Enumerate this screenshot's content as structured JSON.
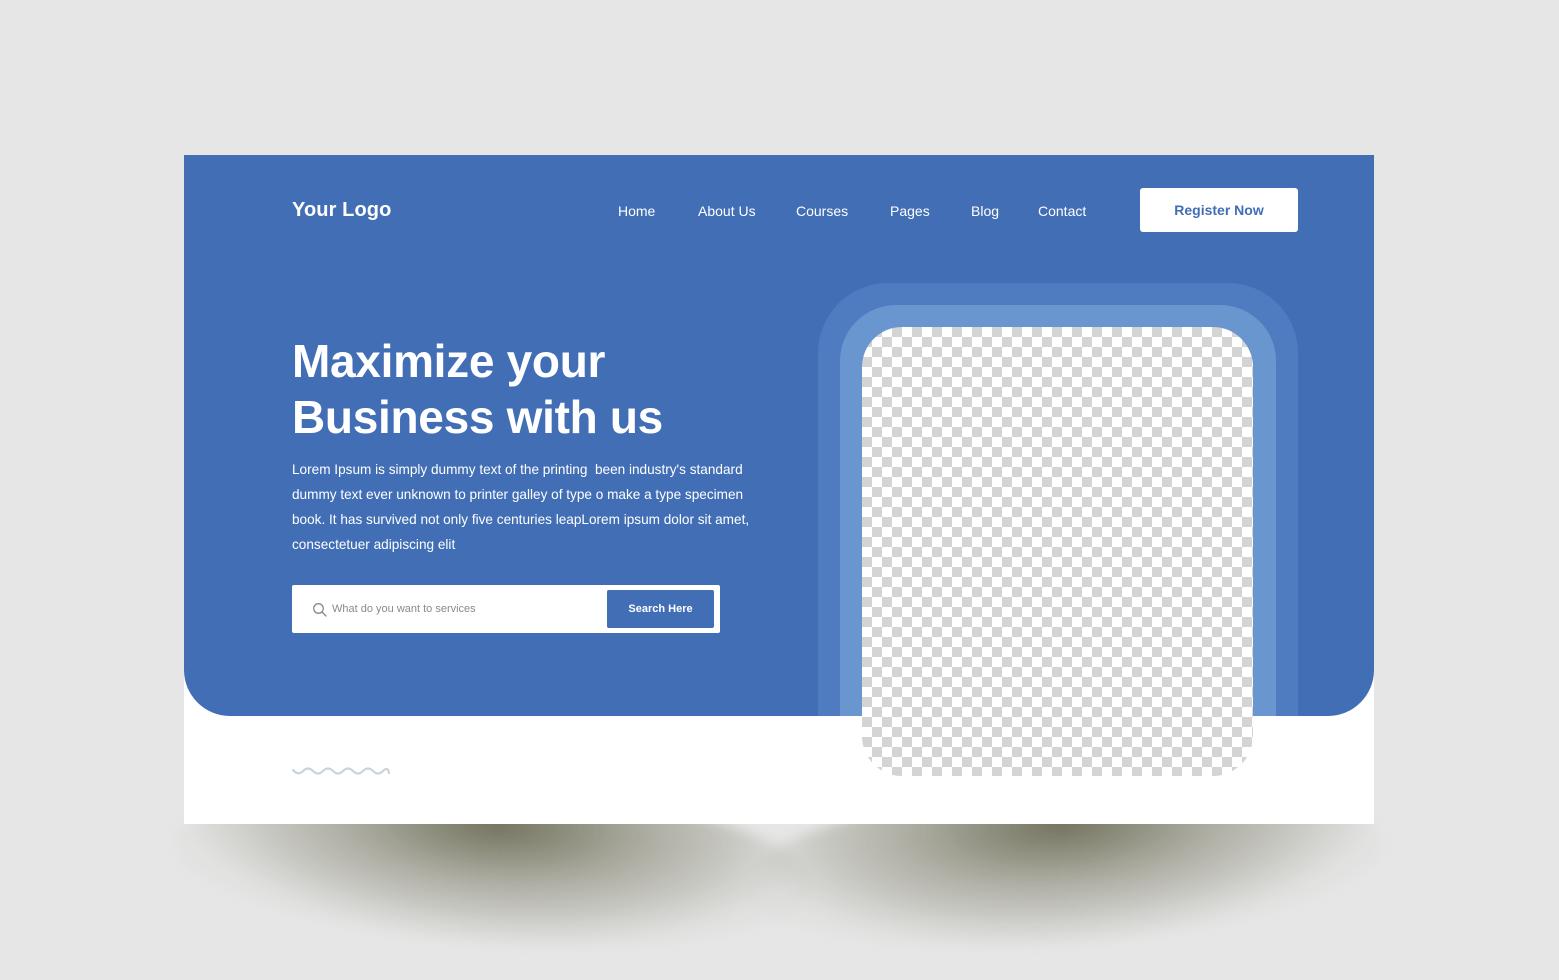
{
  "nav": {
    "logo": "Your Logo",
    "links": [
      {
        "label": "Home"
      },
      {
        "label": "About Us"
      },
      {
        "label": "Courses"
      },
      {
        "label": "Pages"
      },
      {
        "label": "Blog"
      },
      {
        "label": "Contact"
      }
    ],
    "register_label": "Register Now"
  },
  "hero": {
    "headline_line1": "Maximize your",
    "headline_line2": "Business with us",
    "description_lines": [
      "Lorem Ipsum is simply dummy text of the printing  been industry's standard",
      "dummy text ever unknown to printer galley of type o make a type specimen",
      "book. It has survived not only five centuries leapLorem ipsum dolor sit amet,",
      "consectetuer adipiscing elit"
    ]
  },
  "search": {
    "icon": "search-icon",
    "placeholder": "What do you want to services",
    "value": "",
    "button_label": "Search Here"
  },
  "image": {
    "placeholder": "transparent-checkerboard"
  },
  "colors": {
    "brand_blue": "#416eb5",
    "frame_outer": "#4f7cc0",
    "frame_inner": "#6a96cf",
    "page_background": "#e6e6e6",
    "wave": "#c9d3dc"
  }
}
